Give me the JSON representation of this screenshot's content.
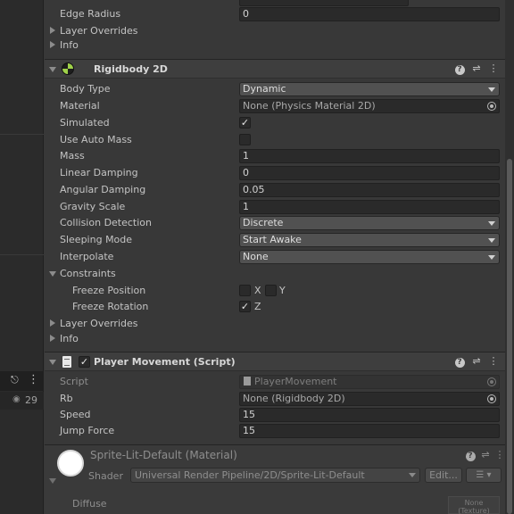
{
  "scene": {
    "eye_count": "29"
  },
  "collider_section": {
    "edge_radius_label": "Edge Radius",
    "edge_radius_value": "0",
    "layer_overrides_label": "Layer Overrides",
    "info_label": "Info"
  },
  "rigidbody": {
    "title": "Rigidbody 2D",
    "rows": {
      "body_type": {
        "label": "Body Type",
        "value": "Dynamic"
      },
      "material": {
        "label": "Material",
        "value": "None (Physics Material 2D)"
      },
      "simulated": {
        "label": "Simulated",
        "checked": true
      },
      "use_auto_mass": {
        "label": "Use Auto Mass",
        "checked": false
      },
      "mass": {
        "label": "Mass",
        "value": "1"
      },
      "linear_damping": {
        "label": "Linear Damping",
        "value": "0"
      },
      "angular_damping": {
        "label": "Angular Damping",
        "value": "0.05"
      },
      "gravity_scale": {
        "label": "Gravity Scale",
        "value": "1"
      },
      "collision_detection": {
        "label": "Collision Detection",
        "value": "Discrete"
      },
      "sleeping_mode": {
        "label": "Sleeping Mode",
        "value": "Start Awake"
      },
      "interpolate": {
        "label": "Interpolate",
        "value": "None"
      }
    },
    "constraints": {
      "label": "Constraints",
      "freeze_position": {
        "label": "Freeze Position",
        "x": "X",
        "y": "Y",
        "x_checked": false,
        "y_checked": false
      },
      "freeze_rotation": {
        "label": "Freeze Rotation",
        "z": "Z",
        "z_checked": true
      }
    },
    "layer_overrides_label": "Layer Overrides",
    "info_label": "Info"
  },
  "player_movement": {
    "title": "Player Movement (Script)",
    "enabled": true,
    "script": {
      "label": "Script",
      "value": "PlayerMovement"
    },
    "rb": {
      "label": "Rb",
      "value": "None (Rigidbody 2D)"
    },
    "speed": {
      "label": "Speed",
      "value": "15"
    },
    "jump_force": {
      "label": "Jump Force",
      "value": "15"
    }
  },
  "material": {
    "title": "Sprite-Lit-Default (Material)",
    "shader_label": "Shader",
    "shader_value": "Universal Render Pipeline/2D/Sprite-Lit-Default",
    "edit_label": "Edit...",
    "diffuse_label": "Diffuse",
    "texture_slot_line1": "None",
    "texture_slot_line2": "(Texture)"
  },
  "glyphs": {
    "check": "✓",
    "help": "?",
    "sliders": "⇌",
    "kebab": "⋮",
    "lock": "🔒",
    "eye": "👁",
    "list": "☰ ▾"
  },
  "colors": {
    "inspector_bg": "#383838",
    "field_bg": "#2a2a2a",
    "dropdown_bg": "#515151",
    "rigidbody_icon_green": "#9fd14a"
  }
}
